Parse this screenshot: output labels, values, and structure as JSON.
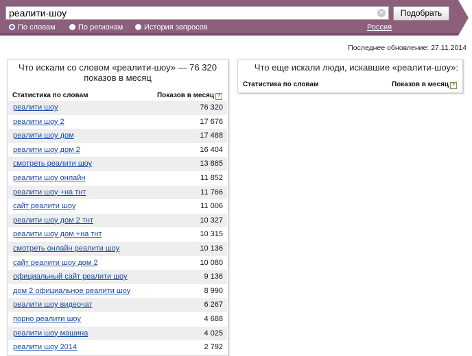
{
  "search": {
    "value": "реалити-шоу",
    "submit_label": "Подобрать",
    "clear_symbol": "×"
  },
  "modes": [
    {
      "label": "По словам",
      "selected": true
    },
    {
      "label": "По регионам",
      "selected": false
    },
    {
      "label": "История запросов",
      "selected": false
    }
  ],
  "region_link": "Россия",
  "last_update": "Последнее обновление: 27.11.2014",
  "left_panel": {
    "title": "Что искали со словом «реалити-шоу» — 76 320 показов в месяц",
    "col_words": "Статистика по словам",
    "col_views": "Показов в месяц",
    "rows": [
      {
        "phrase": "реалити шоу",
        "count": "76 320"
      },
      {
        "phrase": "реалити шоу 2",
        "count": "17 676"
      },
      {
        "phrase": "реалити шоу дом",
        "count": "17 488"
      },
      {
        "phrase": "реалити шоу дом 2",
        "count": "16 404"
      },
      {
        "phrase": "смотреть реалити шоу",
        "count": "13 885"
      },
      {
        "phrase": "реалити шоу онлайн",
        "count": "11 852"
      },
      {
        "phrase": "реалити шоу +на тнт",
        "count": "11 766"
      },
      {
        "phrase": "сайт реалити шоу",
        "count": "11 006"
      },
      {
        "phrase": "реалити шоу дом 2 тнт",
        "count": "10 327"
      },
      {
        "phrase": "реалити шоу дом +на тнт",
        "count": "10 315"
      },
      {
        "phrase": "смотреть онлайн реалити шоу",
        "count": "10 136"
      },
      {
        "phrase": "сайт реалити шоу дом 2",
        "count": "10 080"
      },
      {
        "phrase": "официальный сайт реалити шоу",
        "count": "9 136"
      },
      {
        "phrase": "дом 2 официальное реалити шоу",
        "count": "8 990"
      },
      {
        "phrase": "реалити шоу видеочат",
        "count": "6 267"
      },
      {
        "phrase": "порно реалити шоу",
        "count": "4 688"
      },
      {
        "phrase": "реалити шоу машина",
        "count": "4 025"
      },
      {
        "phrase": "реалити шоу 2014",
        "count": "2 792"
      }
    ]
  },
  "right_panel": {
    "title": "Что еще искали люди, искавшие «реалити-шоу»:",
    "col_words": "Статистика по словам",
    "col_views": "Показов в месяц"
  },
  "colors": {
    "header_bg": "#8c5f7c",
    "header_accent": "#b0245e",
    "link": "#1a4aa8",
    "row_stripe": "#eeeeee"
  },
  "icons": {
    "clear": "clear-icon",
    "help": "help-icon",
    "radio": "radio-icon"
  }
}
